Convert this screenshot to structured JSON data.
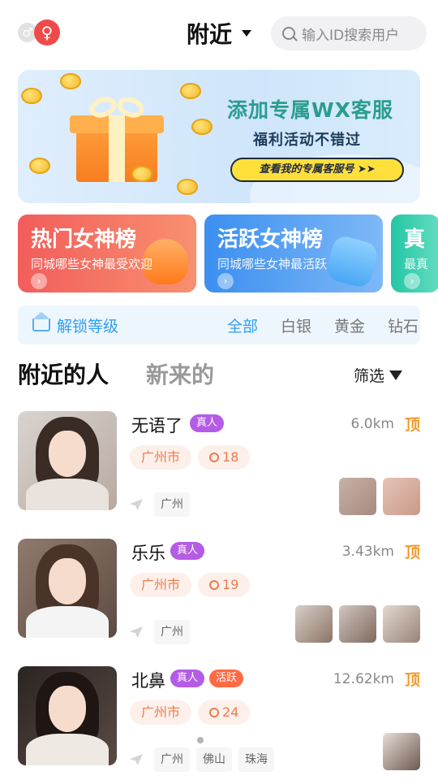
{
  "header": {
    "male_symbol": "♂",
    "female_symbol": "♀",
    "location_title": "附近",
    "search_placeholder": "输入ID搜索用户"
  },
  "banner": {
    "headline": "添加专属WX客服",
    "subline": "福利活动不错过",
    "cta": "查看我的专属客服号 ➤➤"
  },
  "cards": [
    {
      "title": "热门女神榜",
      "desc": "同城哪些女神最受欢迎"
    },
    {
      "title": "活跃女神榜",
      "desc": "同城哪些女神最活跃"
    },
    {
      "title": "真",
      "desc": "最真"
    }
  ],
  "levelbar": {
    "unlock_label": "解锁等级",
    "levels": [
      "全部",
      "白银",
      "黄金",
      "钻石"
    ],
    "selected": "全部"
  },
  "tabs": {
    "nearby": "附近的人",
    "new": "新来的",
    "filter": "筛选"
  },
  "users": [
    {
      "name": "无语了",
      "badges": [
        "真人"
      ],
      "distance": "6.0km",
      "top": "顶",
      "city": "广州市",
      "count": "18",
      "places": [
        "广州"
      ]
    },
    {
      "name": "乐乐",
      "badges": [
        "真人"
      ],
      "distance": "3.43km",
      "top": "顶",
      "city": "广州市",
      "count": "19",
      "places": [
        "广州"
      ]
    },
    {
      "name": "北鼻",
      "badges": [
        "真人",
        "活跃"
      ],
      "distance": "12.62km",
      "top": "顶",
      "city": "广州市",
      "count": "24",
      "places": [
        "广州",
        "佛山",
        "珠海"
      ]
    }
  ],
  "colors": {
    "accent_blue": "#2e9ff0",
    "badge_purple": "#b45ce6",
    "badge_orange": "#ff6a45",
    "top_orange": "#f39a2b"
  }
}
